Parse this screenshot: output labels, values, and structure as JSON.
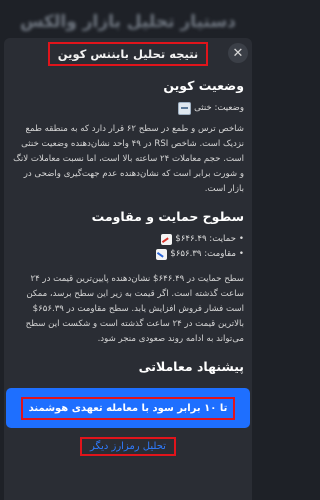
{
  "background": {
    "title": "دستیار تحلیل بازار والکس"
  },
  "modal": {
    "title": "نتیجه تحلیل بایننس کوین",
    "close_icon": "close-icon"
  },
  "sections": {
    "coin_status": {
      "heading": "وضعیت کوین",
      "status_label": "وضعیت: خنثی",
      "status_icon": "neutral-face-icon",
      "paragraph": "شاخص ترس و طمع در سطح ۶۲ قرار دارد که به منطقه طمع نزدیک است. شاخص RSI در ۴۹ واحد نشان‌دهنده وضعیت خنثی است. حجم معاملات ۲۴ ساعته بالا است، اما نسبت معاملات لانگ و شورت برابر است که نشان‌دهنده عدم جهت‌گیری واضحی در بازار است."
    },
    "levels": {
      "heading": "سطوح حمایت و مقاومت",
      "support_label": "حمایت: ۶۴۶.۴۹$",
      "support_icon": "chart-increasing-icon",
      "resistance_label": "مقاومت: ۶۵۶.۳۹$",
      "resistance_icon": "chart-decreasing-icon",
      "paragraph": "سطح حمایت در ۶۴۶.۴۹$ نشان‌دهنده پایین‌ترین قیمت در ۲۴ ساعت گذشته است. اگر قیمت به زیر این سطح برسد، ممکن است فشار فروش افزایش یابد. سطح مقاومت در ۶۵۶.۳۹$ بالاترین قیمت در ۲۴ ساعت گذشته است و شکست این سطح می‌تواند به ادامه روند صعودی منجر شود."
    },
    "trade": {
      "heading": "پیشنهاد معاملاتی"
    }
  },
  "actions": {
    "primary_label": "تا ۱۰ برابر سود با معامله تعهدی هوشمند",
    "secondary_label": "تحلیل رمزارز دیگر"
  },
  "colors": {
    "primary_button": "#1e6fff",
    "highlight_border": "#e0141b",
    "link": "#2f7cff"
  }
}
